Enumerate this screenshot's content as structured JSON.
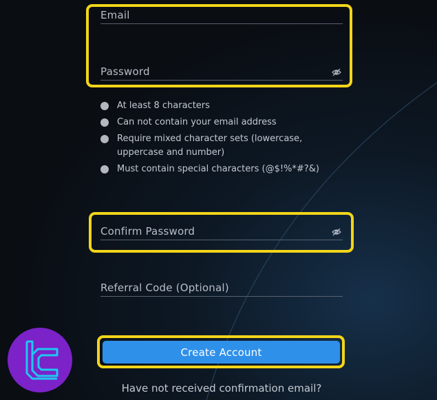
{
  "form": {
    "email_label": "Email",
    "password_label": "Password",
    "confirm_password_label": "Confirm Password",
    "referral_label": "Referral Code (Optional)",
    "submit_label": "Create Account",
    "resend_text": "Have not received confirmation email?"
  },
  "password_rules": [
    "At least 8 characters",
    "Can not contain your email address",
    "Require mixed character sets (lowercase, uppercase and number)",
    "Must contain special characters (@$!%*#?&)"
  ],
  "colors": {
    "highlight": "#f2d51a",
    "button": "#2f90ea",
    "background": "#0a0d12",
    "logo_badge": "#7b22c9",
    "logo_glyph": "#1ec8f0"
  },
  "icons": {
    "password_toggle": "eye-slash-icon",
    "logo": "tc-logo-icon"
  }
}
